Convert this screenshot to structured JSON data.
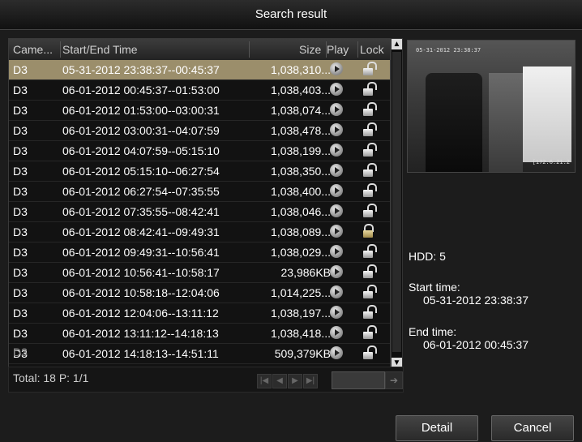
{
  "window": {
    "title": "Search result"
  },
  "table": {
    "columns": [
      "Came...",
      "Start/End Time",
      "Size",
      "Play",
      "Lock"
    ],
    "rows": [
      {
        "camera": "D3",
        "time": "05-31-2012 23:38:37--00:45:37",
        "size": "1,038,310...",
        "locked": false,
        "selected": true
      },
      {
        "camera": "D3",
        "time": "06-01-2012 00:45:37--01:53:00",
        "size": "1,038,403...",
        "locked": false
      },
      {
        "camera": "D3",
        "time": "06-01-2012 01:53:00--03:00:31",
        "size": "1,038,074...",
        "locked": false
      },
      {
        "camera": "D3",
        "time": "06-01-2012 03:00:31--04:07:59",
        "size": "1,038,478...",
        "locked": false
      },
      {
        "camera": "D3",
        "time": "06-01-2012 04:07:59--05:15:10",
        "size": "1,038,199...",
        "locked": false
      },
      {
        "camera": "D3",
        "time": "06-01-2012 05:15:10--06:27:54",
        "size": "1,038,350...",
        "locked": false
      },
      {
        "camera": "D3",
        "time": "06-01-2012 06:27:54--07:35:55",
        "size": "1,038,400...",
        "locked": false
      },
      {
        "camera": "D3",
        "time": "06-01-2012 07:35:55--08:42:41",
        "size": "1,038,046...",
        "locked": false
      },
      {
        "camera": "D3",
        "time": "06-01-2012 08:42:41--09:49:31",
        "size": "1,038,089...",
        "locked": true
      },
      {
        "camera": "D3",
        "time": "06-01-2012 09:49:31--10:56:41",
        "size": "1,038,029...",
        "locked": false
      },
      {
        "camera": "D3",
        "time": "06-01-2012 10:56:41--10:58:17",
        "size": "23,986KB",
        "locked": false
      },
      {
        "camera": "D3",
        "time": "06-01-2012 10:58:18--12:04:06",
        "size": "1,014,225...",
        "locked": false
      },
      {
        "camera": "D3",
        "time": "06-01-2012 12:04:06--13:11:12",
        "size": "1,038,197...",
        "locked": false
      },
      {
        "camera": "D3",
        "time": "06-01-2012 13:11:12--14:18:13",
        "size": "1,038,418...",
        "locked": false
      },
      {
        "camera": "D3",
        "time": "06-01-2012 14:18:13--14:51:11",
        "size": "509,379KB",
        "locked": false
      }
    ]
  },
  "footer": {
    "total_text": "Total: 18  P: 1/1",
    "page_input": ""
  },
  "preview": {
    "timestamp": "05-31-2012 23:38:37",
    "ip_text": "[172.6.21.2"
  },
  "info": {
    "hdd": "HDD: 5",
    "start_label": "Start time:",
    "start_value": "05-31-2012 23:38:37",
    "end_label": "End time:",
    "end_value": "06-01-2012 00:45:37"
  },
  "buttons": {
    "detail": "Detail",
    "cancel": "Cancel"
  },
  "colors": {
    "selected_row": "#9b8e6b",
    "background": "#1c1c1c"
  },
  "icons": {
    "play": "play-circle-icon",
    "unlock": "unlocked-padlock-icon",
    "lock": "locked-padlock-icon"
  }
}
